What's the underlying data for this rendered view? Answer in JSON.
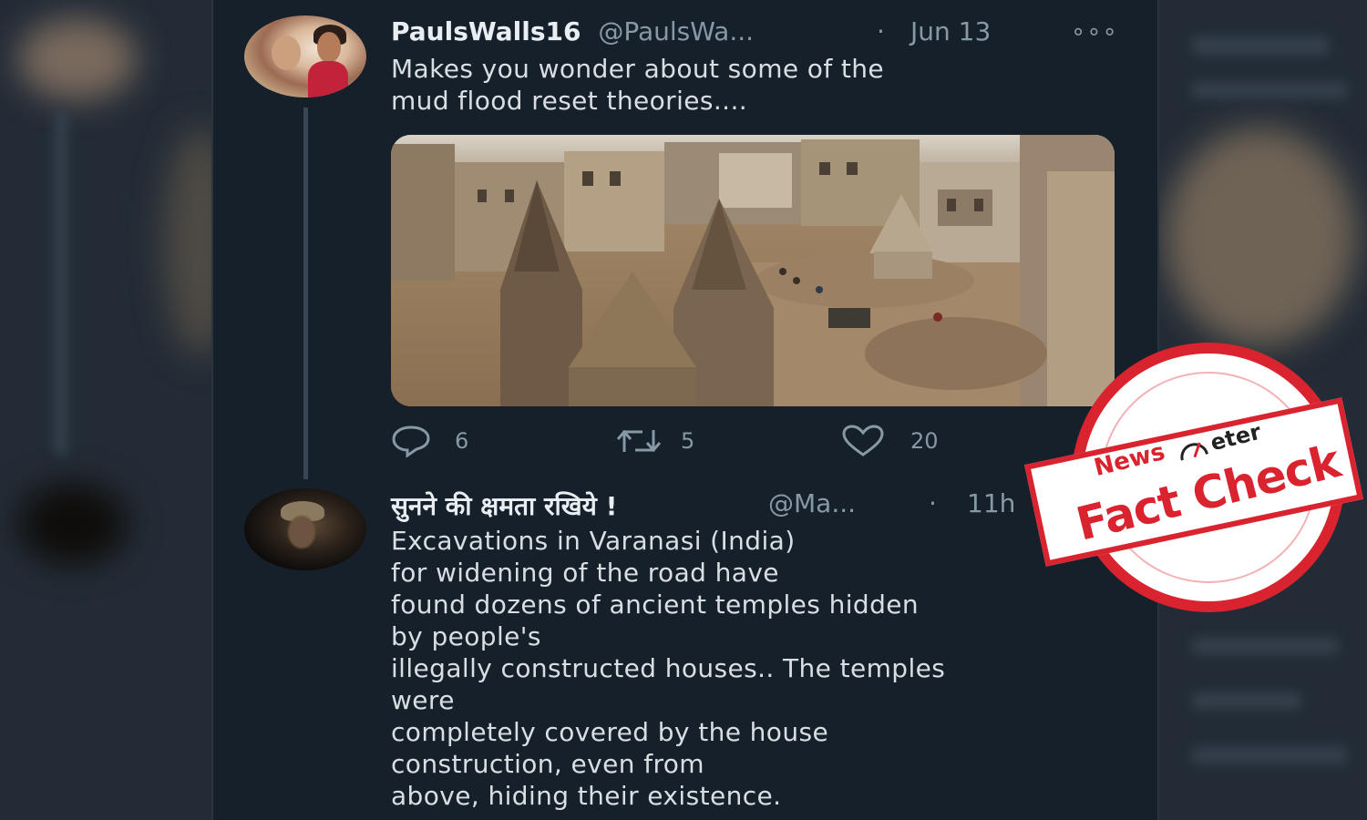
{
  "tweets": [
    {
      "name": "PaulsWalls16",
      "handle": "@PaulsWa...",
      "separator": "·",
      "date": "Jun 13",
      "text_lines": [
        "Makes you wonder about some of the",
        "mud flood reset theories...."
      ],
      "actions": {
        "reply": {
          "icon": "reply-icon",
          "count": "6"
        },
        "retweet": {
          "icon": "retweet-icon",
          "count": "5"
        },
        "like": {
          "icon": "heart-icon",
          "count": "20"
        }
      },
      "more_icon": "more-options-icon"
    },
    {
      "name": "सुनने की क्षमता रखिये !",
      "handle": "@Ma...",
      "separator": "·",
      "date": "11h",
      "text_lines": [
        "Excavations in Varanasi (India)",
        "for widening of the road have",
        "found dozens of ancient temples hidden",
        "by people's",
        "illegally constructed houses.. The temples",
        "were",
        "completely covered by the house",
        "construction, even from",
        "above, hiding their existence."
      ]
    }
  ],
  "stamp": {
    "brand_news": "News",
    "brand_meter": "eter",
    "label": "Fact Check",
    "color": "#d9232f"
  },
  "colors": {
    "background": "#15202b",
    "text": "#d9dee3",
    "muted": "#8899a6"
  }
}
